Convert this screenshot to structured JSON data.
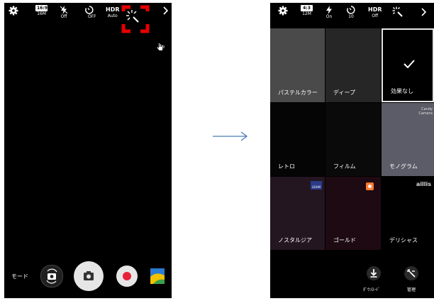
{
  "left": {
    "topbar": {
      "resolution_ratio": "16:9",
      "resolution_size": "16M",
      "flash_status": "Off",
      "timer_status": "OFF",
      "hdr_label": "HDR",
      "hdr_status": "Auto"
    },
    "mode_label": "モード",
    "highlight_color": "#e60000"
  },
  "right": {
    "topbar": {
      "resolution_ratio": "4:3",
      "resolution_size": "12M",
      "flash_status": "On",
      "timer_status": "10",
      "hdr_label": "HDR",
      "hdr_status": "Off"
    },
    "filters": [
      {
        "label": "パステルカラー",
        "bg": "#4a4a4a"
      },
      {
        "label": "ディープ",
        "bg": "#262626"
      },
      {
        "label": "効果なし",
        "bg": "#000000",
        "selected": true
      },
      {
        "label": "レトロ",
        "bg": "#050505"
      },
      {
        "label": "フィルム",
        "bg": "#0a0a0a"
      },
      {
        "label": "モノグラム",
        "bg": "#5c5c68",
        "badge": "Candy Camera"
      },
      {
        "label": "ノスタルジア",
        "bg": "#241620",
        "badge": "UGAM"
      },
      {
        "label": "ゴールド",
        "bg": "#1e0a12"
      },
      {
        "label": "デリシャス",
        "bg": "#000000",
        "badge": "aillis"
      }
    ],
    "download_label": "ﾀﾞｳﾝﾛｰﾄﾞ",
    "manage_label": "管理"
  }
}
